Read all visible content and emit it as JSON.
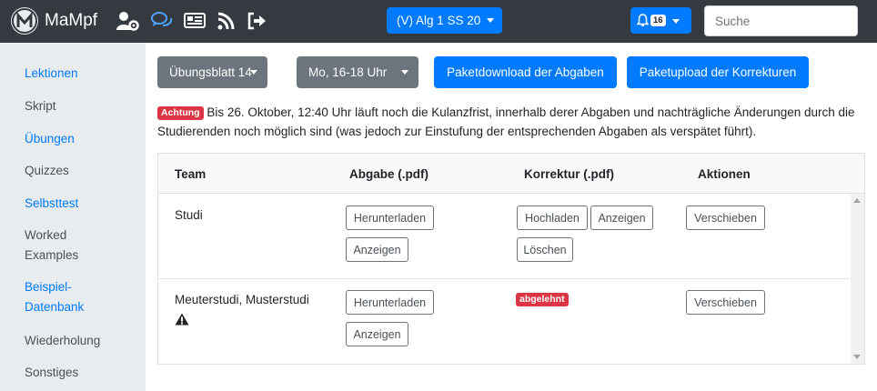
{
  "navbar": {
    "brand": "MaMpf",
    "icons": [
      "mampf-logo-icon",
      "user-settings-icon",
      "comments-icon",
      "news-icon",
      "feed-icon",
      "logout-icon"
    ],
    "lecture_label": "(V) Alg 1 SS 20",
    "notification_count": "16",
    "search_placeholder": "Suche"
  },
  "sidebar": {
    "items": [
      {
        "label": "Lektionen",
        "link": true
      },
      {
        "label": "Skript",
        "link": false
      },
      {
        "label": "Übungen",
        "link": true
      },
      {
        "label": "Quizzes",
        "link": false
      },
      {
        "label": "Selbsttest",
        "link": true
      },
      {
        "label": "Worked Examples",
        "link": false
      },
      {
        "label": "Beispiel-Datenbank",
        "link": true
      },
      {
        "label": "Wiederholung",
        "link": false
      },
      {
        "label": "Sonstiges",
        "link": false
      }
    ]
  },
  "toolbar": {
    "assignment": "Übungsblatt 14",
    "tutorial": "Mo, 16-18 Uhr",
    "download": "Paketdownload der Abgaben",
    "upload": "Paketupload der Korrekturen"
  },
  "notice": {
    "badge": "Achtung",
    "text": "Bis 26. Oktober, 12:40 Uhr läuft noch die Kulanzfrist, innerhalb derer Abgaben und nachträgliche Änderungen durch die Studierenden noch möglich sind (was jedoch zur Einstufung der entsprechenden Abgaben als verspätet führt)."
  },
  "table": {
    "headers": [
      "Team",
      "Abgabe (.pdf)",
      "Korrektur (.pdf)",
      "Aktionen"
    ],
    "rows": [
      {
        "team": "Studi",
        "submission_buttons": [
          "Herunterladen",
          "Anzeigen"
        ],
        "correction_buttons": [
          "Hochladen",
          "Anzeigen",
          "Löschen"
        ],
        "action_button": "Verschieben"
      },
      {
        "team": "Meuterstudi, Musterstudi",
        "warning_icon": "warning-triangle-icon",
        "submission_buttons": [
          "Herunterladen",
          "Anzeigen"
        ],
        "correction_badge": "abgelehnt",
        "action_button": "Verschieben"
      }
    ]
  },
  "colors": {
    "navbar": "#343a40",
    "primary": "#007bff",
    "secondary": "#6c757d",
    "danger": "#dc3545",
    "sidebar": "#e9ecef"
  }
}
